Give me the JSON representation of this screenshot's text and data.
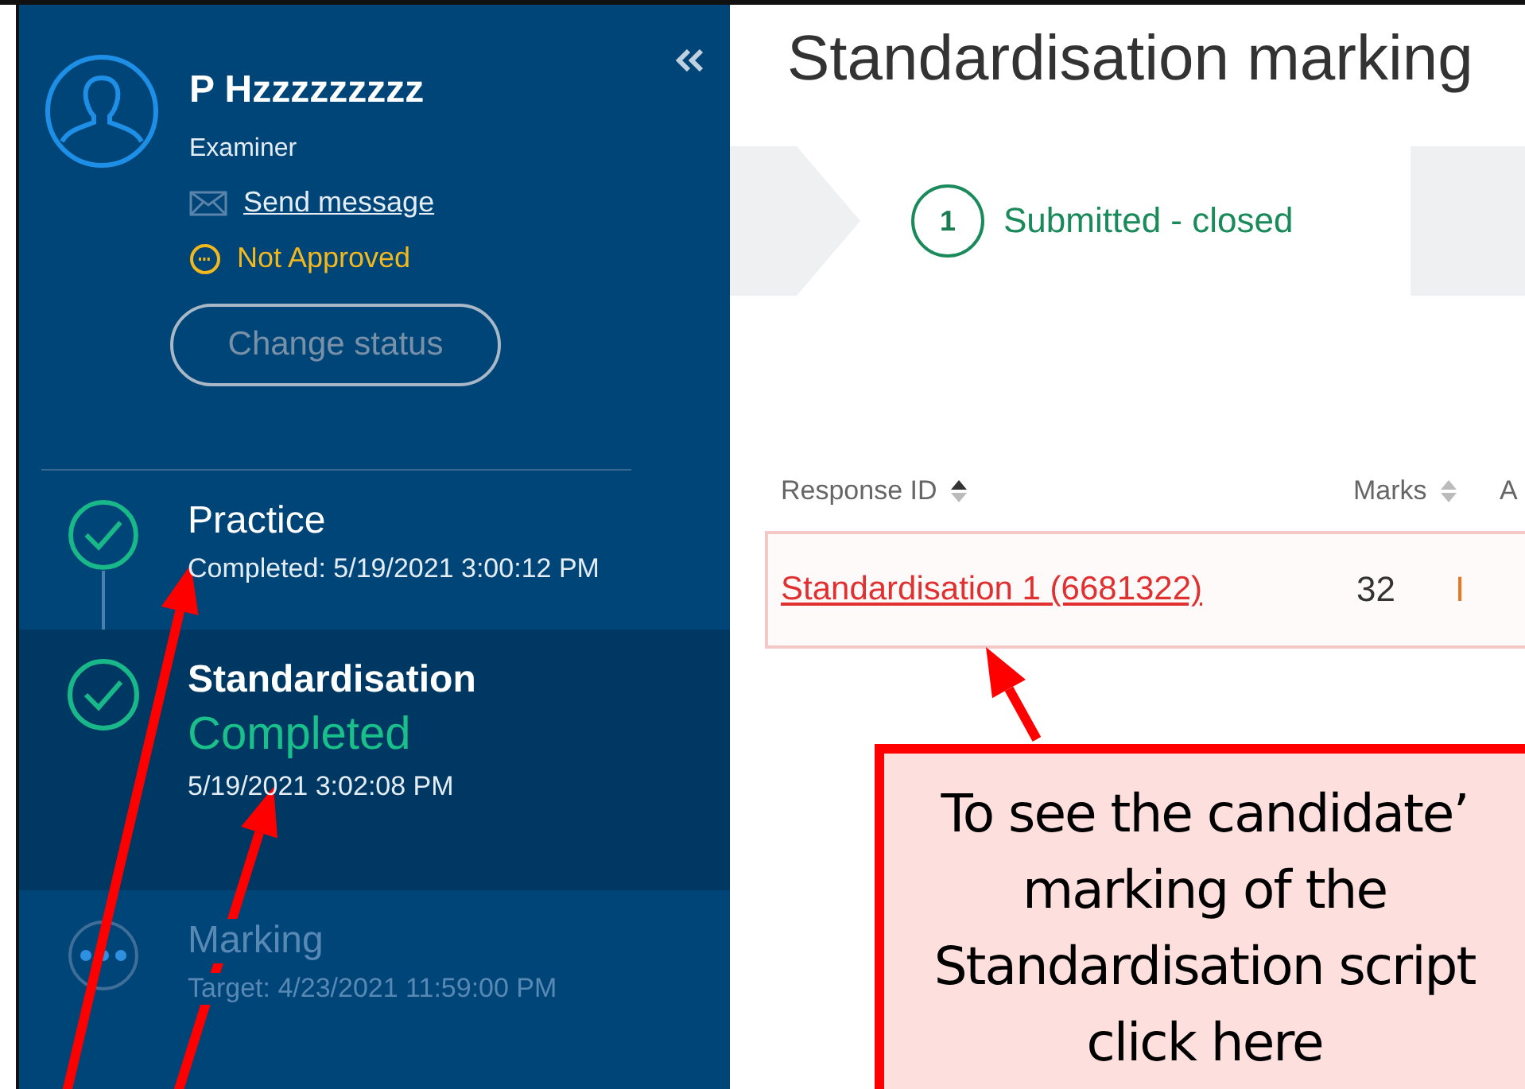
{
  "sidebar": {
    "user": {
      "name": "P Hzzzzzzzzz",
      "role": "Examiner",
      "message_link": "Send message",
      "status": "Not Approved",
      "change_status_button": {
        "label": "Change status",
        "disabled": true
      }
    },
    "steps": [
      {
        "title": "Practice",
        "completed": true,
        "selected": false,
        "detail": "Completed:  5/19/2021 3:00:12 PM"
      },
      {
        "title": "Standardisation",
        "completed": true,
        "selected": true,
        "status_text": "Completed",
        "detail": "5/19/2021 3:02:08 PM"
      },
      {
        "title": "Marking",
        "completed": false,
        "selected": false,
        "detail": "Target:  4/23/2021 11:59:00 PM"
      }
    ]
  },
  "main": {
    "title": "Standardisation marking",
    "stepper": [
      {
        "number": "1",
        "label": "Submitted - closed",
        "selected": true
      }
    ],
    "table": {
      "columns": [
        {
          "label": "Response ID",
          "sorted": true
        },
        {
          "label": "Marks",
          "sorted": false
        },
        {
          "label": "A"
        }
      ],
      "rows": [
        {
          "response_id": "Standardisation 1 (6681322)",
          "marks": "32",
          "column_3": "I"
        }
      ]
    }
  },
  "callout": {
    "lines": [
      "To see the candidate’",
      "marking of the",
      "Standardisation script",
      "click here"
    ]
  }
}
